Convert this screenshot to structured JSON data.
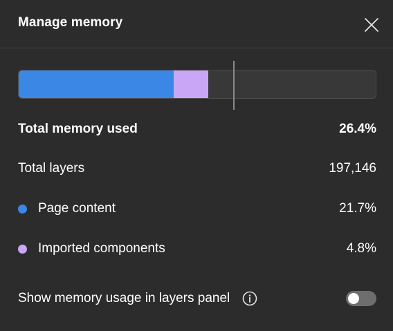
{
  "dialog": {
    "title": "Manage memory"
  },
  "memory_bar": {
    "page_content_fraction": 0.217,
    "imported_components_fraction": 0.048,
    "limit_marker_fraction": 0.6,
    "colors": {
      "page_content": "#3b87e5",
      "imported_components": "#c9a7f6",
      "track": "#383838"
    }
  },
  "stats": {
    "total_memory": {
      "label": "Total memory used",
      "value": "26.4%"
    },
    "total_layers": {
      "label": "Total layers",
      "value": "197,146"
    },
    "page_content": {
      "label": "Page content",
      "value": "21.7%"
    },
    "imported_components": {
      "label": "Imported components",
      "value": "4.8%"
    }
  },
  "setting": {
    "label": "Show memory usage in layers panel",
    "toggle_on": false
  },
  "icons": {
    "close": "close-icon",
    "info": "info-icon"
  }
}
